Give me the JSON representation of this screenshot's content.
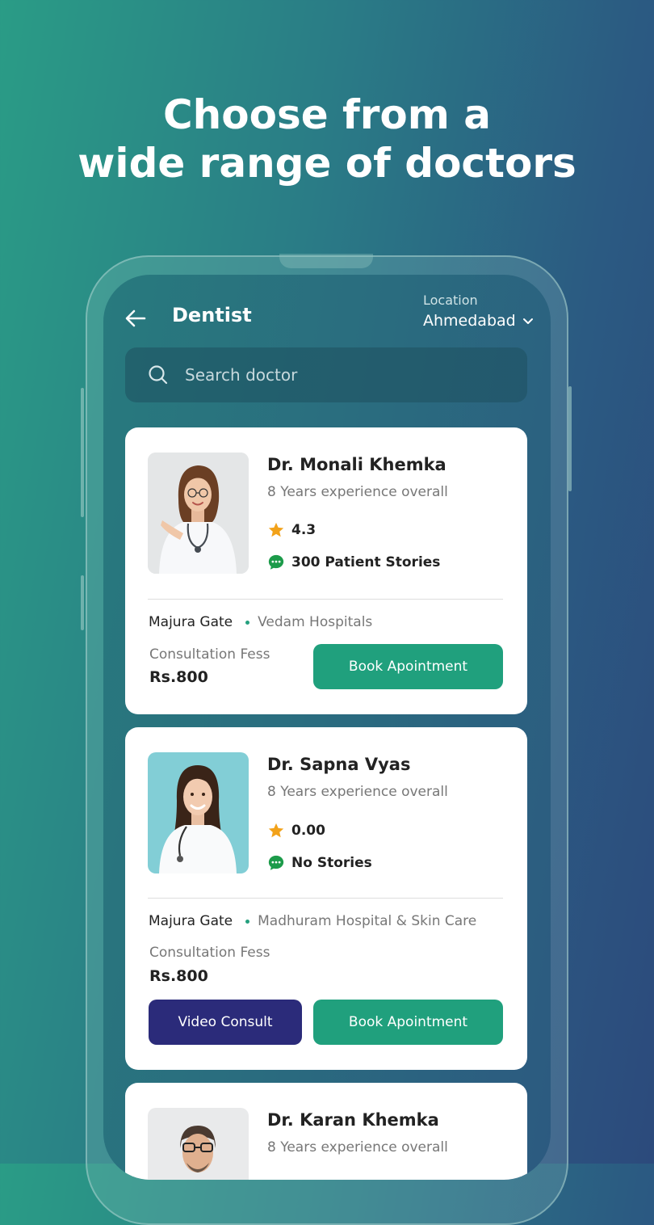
{
  "headline": {
    "line1": "Choose from a",
    "line2": "wide range of doctors"
  },
  "header": {
    "title": "Dentist",
    "location_label": "Location",
    "location_value": "Ahmedabad"
  },
  "search": {
    "placeholder": "Search doctor"
  },
  "colors": {
    "accent_green": "#20a07d",
    "video_button": "#2b2b7a",
    "star": "#f2a21a",
    "chat_icon": "#1c9b4a"
  },
  "doctors": [
    {
      "name": "Dr. Monali Khemka",
      "experience": "8 Years experience overall",
      "rating": "4.3",
      "stories": "300 Patient Stories",
      "area": "Majura Gate",
      "hospital": "Vedam Hospitals",
      "fee_label": "Consultation Fess",
      "fee": "Rs.800",
      "book_label": "Book Apointment"
    },
    {
      "name": "Dr. Sapna Vyas",
      "experience": "8 Years experience overall",
      "rating": "0.00",
      "stories": "No Stories",
      "area": "Majura Gate",
      "hospital": "Madhuram Hospital & Skin Care",
      "fee_label": "Consultation Fess",
      "fee": "Rs.800",
      "video_label": "Video Consult",
      "book_label": "Book Apointment"
    },
    {
      "name": "Dr. Karan Khemka",
      "experience": "8 Years experience overall"
    }
  ]
}
